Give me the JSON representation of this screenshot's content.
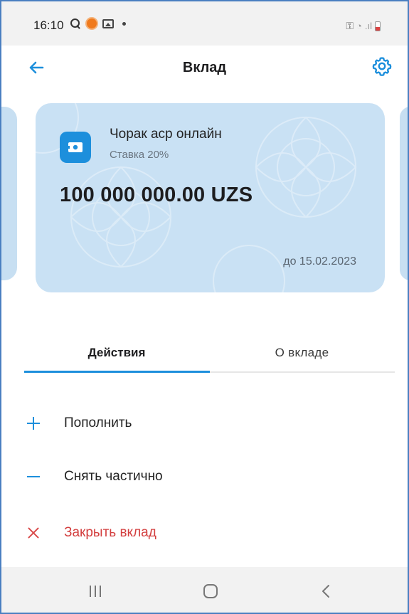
{
  "status_bar": {
    "time": "16:10"
  },
  "header": {
    "title": "Вклад"
  },
  "deposit_card": {
    "name": "Чорак аср онлайн",
    "rate": "Ставка 20%",
    "amount": "100 000 000.00 UZS",
    "until": "до 15.02.2023"
  },
  "tabs": {
    "actions": "Действия",
    "about": "О вкладе",
    "active": "actions"
  },
  "actions": [
    {
      "label": "Пополнить",
      "icon": "plus-icon"
    },
    {
      "label": "Снять частично",
      "icon": "minus-icon"
    },
    {
      "label": "Закрыть вклад",
      "icon": "close-icon"
    }
  ],
  "colors": {
    "accent": "#1d8fdc",
    "danger": "#d33f3f",
    "card_bg": "#c9e1f4"
  }
}
